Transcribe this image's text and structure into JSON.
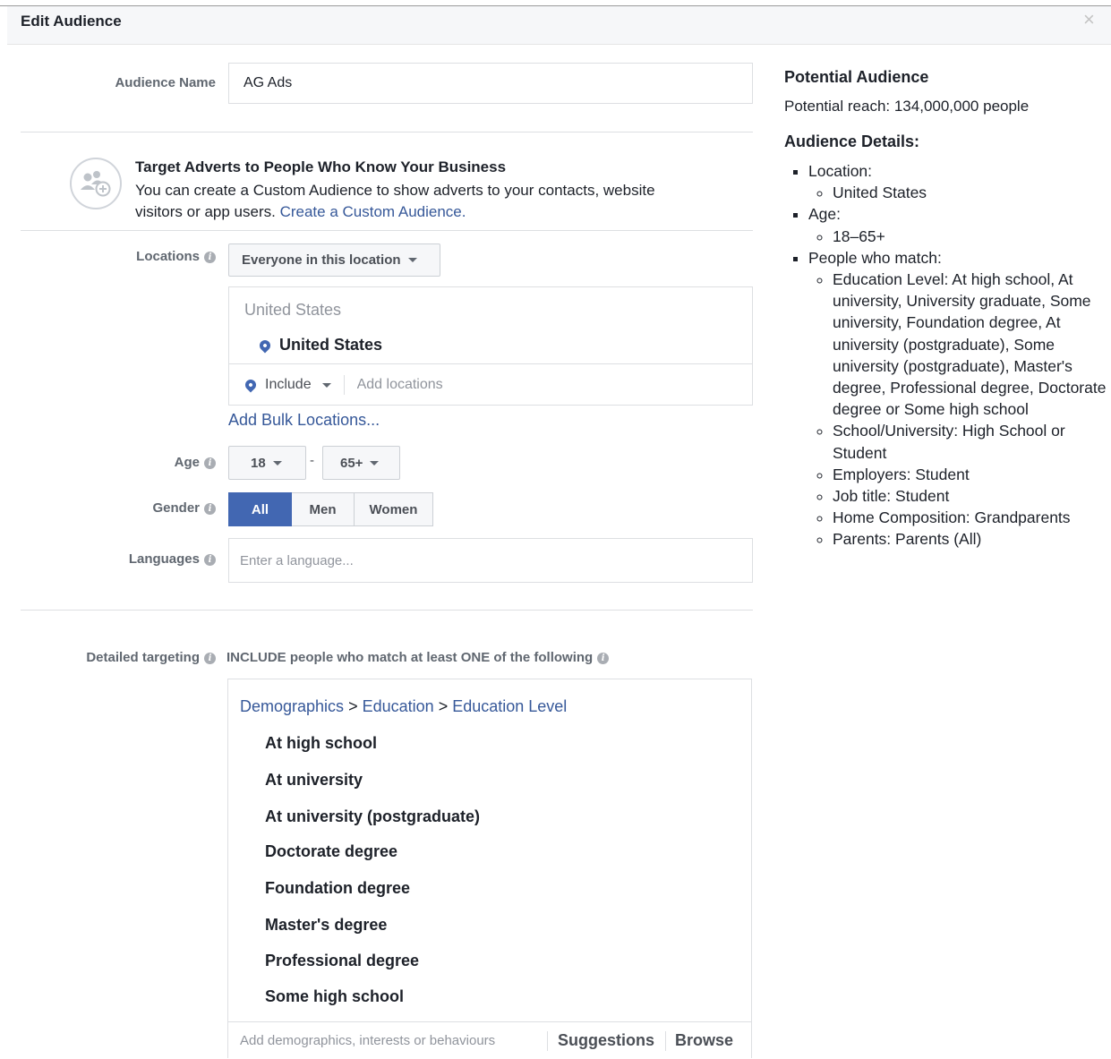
{
  "header": {
    "title": "Edit Audience",
    "close_icon": "×"
  },
  "audience_name": {
    "label": "Audience Name",
    "value": "AG Ads"
  },
  "custom_audience": {
    "title": "Target Adverts to People Who Know Your Business",
    "text": "You can create a Custom Audience to show adverts to your contacts, website visitors or app users.",
    "link": "Create a Custom Audience."
  },
  "locations": {
    "label": "Locations",
    "dropdown": "Everyone in this location",
    "country_header": "United States",
    "selected": "United States",
    "include_label": "Include",
    "add_placeholder": "Add locations",
    "bulk_link": "Add Bulk Locations..."
  },
  "age": {
    "label": "Age",
    "min": "18",
    "separator": "-",
    "max": "65+"
  },
  "gender": {
    "label": "Gender",
    "options": [
      "All",
      "Men",
      "Women"
    ],
    "selected": "All"
  },
  "languages": {
    "label": "Languages",
    "placeholder": "Enter a language..."
  },
  "detailed_targeting": {
    "label": "Detailed targeting",
    "description": "INCLUDE people who match at least ONE of the following",
    "breadcrumb": [
      "Demographics",
      "Education",
      "Education Level"
    ],
    "breadcrumb_separator": ">",
    "items": [
      "At high school",
      "At university",
      "At university (postgraduate)",
      "Doctorate degree",
      "Foundation degree",
      "Master's degree",
      "Professional degree",
      "Some high school"
    ],
    "input_placeholder": "Add demographics, interests or behaviours",
    "suggestions_label": "Suggestions",
    "browse_label": "Browse"
  },
  "potential_audience": {
    "title": "Potential Audience",
    "reach": "Potential reach: 134,000,000 people",
    "details_title": "Audience Details:",
    "location_label": "Location:",
    "location_value": "United States",
    "age_label": "Age:",
    "age_value": "18–65+",
    "match_label": "People who match:",
    "match_items": [
      "Education Level: At high school, At university, University graduate, Some university, Foundation degree, At university (postgraduate), Some university (postgraduate), Master's degree, Professional degree, Doctorate degree or Some high school",
      "School/University: High School or Student",
      "Employers: Student",
      "Job title: Student",
      "Home Composition: Grandparents",
      "Parents: Parents (All)"
    ]
  },
  "colors": {
    "accent": "#4267b2",
    "link": "#365899",
    "label_gray": "#606770",
    "border": "#dddfe2"
  }
}
